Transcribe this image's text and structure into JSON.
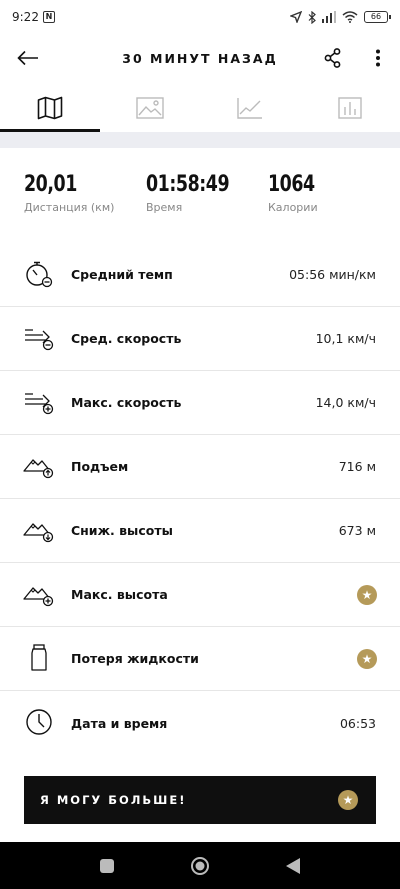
{
  "status": {
    "time": "9:22",
    "notification_badge": "N",
    "battery": "66"
  },
  "header": {
    "title": "30 МИНУТ НАЗАД"
  },
  "tabs": [
    {
      "name": "map",
      "icon": "map-icon",
      "active": true
    },
    {
      "name": "photo",
      "icon": "image-icon",
      "active": false
    },
    {
      "name": "chart",
      "icon": "line-chart-icon",
      "active": false
    },
    {
      "name": "stats",
      "icon": "bar-chart-icon",
      "active": false
    }
  ],
  "summary": {
    "distance": {
      "value": "20,01",
      "label": "Дистанция (км)"
    },
    "time": {
      "value": "01:58:49",
      "label": "Время"
    },
    "calories": {
      "value": "1064",
      "label": "Калории"
    }
  },
  "metrics": [
    {
      "label": "Средний темп",
      "value": "05:56 мин/км",
      "icon": "stopwatch-pace-icon"
    },
    {
      "label": "Сред. скорость",
      "value": "10,1 км/ч",
      "icon": "speed-average-icon"
    },
    {
      "label": "Макс. скорость",
      "value": "14,0 км/ч",
      "icon": "speed-max-icon"
    },
    {
      "label": "Подъем",
      "value": "716 м",
      "icon": "elevation-up-icon"
    },
    {
      "label": "Сниж. высоты",
      "value": "673 м",
      "icon": "elevation-down-icon"
    },
    {
      "label": "Макс. высота",
      "value": "",
      "icon": "elevation-max-icon",
      "premium": true
    },
    {
      "label": "Потеря жидкости",
      "value": "",
      "icon": "bottle-icon",
      "premium": true
    },
    {
      "label": "Дата и время",
      "value": "06:53",
      "icon": "clock-icon"
    }
  ],
  "cta": {
    "label": "Я МОГУ БОЛЬШЕ!"
  },
  "colors": {
    "accent_gold": "#b59a59",
    "tab_gap": "#ecedf2"
  }
}
